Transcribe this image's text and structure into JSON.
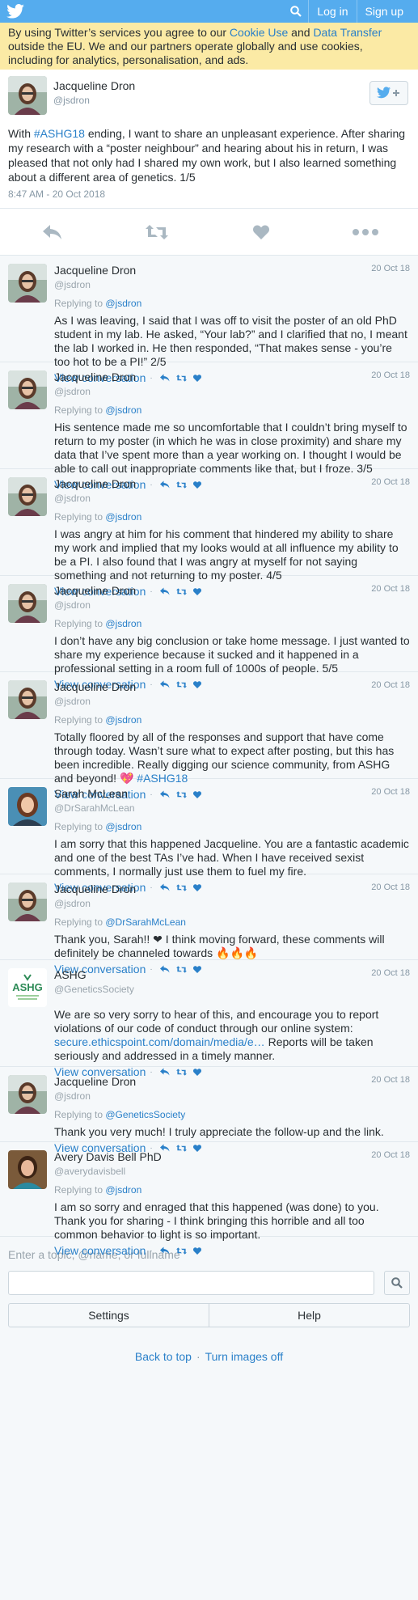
{
  "topbar": {
    "login": "Log in",
    "signup": "Sign up"
  },
  "cookie": {
    "pre": "By using Twitter’s services you agree to our ",
    "cookie_link": "Cookie Use",
    "mid": " and ",
    "transfer_link": "Data Transfer",
    "post": " outside the EU. We and our partners operate globally and use cookies, including for analytics, personalisation, and ads."
  },
  "main_tweet": {
    "name": "Jacqueline Dron",
    "handle": "@jsdron",
    "text_pre": "With ",
    "hashtag": "#ASHG18",
    "text_post": " ending, I want to share an unpleasant experience. After sharing my research with a “poster neighbour” and hearing about his in return, I was pleased that not only had I shared my own work, but I also learned something about a different area of genetics. 1/5",
    "time": "8:47 AM - 20 Oct 2018"
  },
  "tweets": [
    {
      "name": "Jacqueline Dron",
      "handle": "@jsdron",
      "date": "20 Oct 18",
      "replying": "Replying to ",
      "reply_to": "@jsdron",
      "text": "As I was leaving, I said that I was off to visit the poster of an old PhD student in my lab. He asked, “Your lab?” and I clarified that no, I meant the lab I worked in. He then responded, “That makes sense - you’re too hot to be a PI!” 2/5",
      "view": "View conversation"
    },
    {
      "name": "Jacqueline Dron",
      "handle": "@jsdron",
      "date": "20 Oct 18",
      "replying": "Replying to ",
      "reply_to": "@jsdron",
      "text": "His sentence made me so uncomfortable that I couldn’t bring myself to return to my poster (in which he was in close proximity) and share my data that I’ve spent more than a year working on. I thought I would be able to call out inappropriate comments like that, but I froze. 3/5",
      "view": "View conversation"
    },
    {
      "name": "Jacqueline Dron",
      "handle": "@jsdron",
      "date": "20 Oct 18",
      "replying": "Replying to ",
      "reply_to": "@jsdron",
      "text": "I was angry at him for his comment that hindered my ability to share my work and implied that my looks would at all influence my ability to be a PI. I also found that I was angry at myself for not saying something and not returning to my poster. 4/5",
      "view": "View conversation"
    },
    {
      "name": "Jacqueline Dron",
      "handle": "@jsdron",
      "date": "20 Oct 18",
      "replying": "Replying to ",
      "reply_to": "@jsdron",
      "text": "I don’t have any big conclusion or take home message. I just wanted to share my experience because it sucked and it happened in a professional setting in a room full of 1000s of people. 5/5",
      "view": "View conversation"
    },
    {
      "name": "Jacqueline Dron",
      "handle": "@jsdron",
      "date": "20 Oct 18",
      "replying": "Replying to ",
      "reply_to": "@jsdron",
      "text": "Totally floored by all of the responses and support that have come through today. Wasn’t sure what to expect after posting, but this has been incredible. Really digging our science community, from ASHG and beyond! 💖 ",
      "text_link": "#ASHG18",
      "view": "View conversation"
    },
    {
      "name": "Sarah McLean",
      "handle": "@DrSarahMcLean",
      "date": "20 Oct 18",
      "replying": "Replying to ",
      "reply_to": "@jsdron",
      "text": "I am sorry that this happened Jacqueline. You are a fantastic academic and one of the best TAs I’ve had. When I have received sexist comments, I normally just use them to fuel my fire.",
      "view": "View conversation"
    },
    {
      "name": "Jacqueline Dron",
      "handle": "@jsdron",
      "date": "20 Oct 18",
      "replying": "Replying to ",
      "reply_to": "@DrSarahMcLean",
      "text": "Thank you, Sarah!! ❤ I think moving forward, these comments will definitely be channeled towards 🔥🔥🔥",
      "view": "View conversation"
    },
    {
      "name": "ASHG",
      "handle": "@GeneticsSociety",
      "date": "20 Oct 18",
      "replying": "",
      "text": "We are so very sorry to hear of this, and encourage you to report violations of our code of conduct through our online system: ",
      "text_link": "secure.ethicspoint.com/domain/media/e…",
      "text_after": " Reports will be taken seriously and addressed in a timely manner.",
      "view": "View conversation"
    },
    {
      "name": "Jacqueline Dron",
      "handle": "@jsdron",
      "date": "20 Oct 18",
      "replying": "Replying to ",
      "reply_to": "@GeneticsSociety",
      "text": "Thank you very much! I truly appreciate the follow-up and the link.",
      "view": "View conversation"
    },
    {
      "name": "Avery Davis Bell PhD",
      "handle": "@averydavisbell",
      "date": "20 Oct 18",
      "replying": "Replying to ",
      "reply_to": "@jsdron",
      "text": "I am so sorry and enraged that this happened (was done) to you. Thank you for sharing - I think bringing this horrible and all too common behavior to light is so important.",
      "view": "View conversation"
    }
  ],
  "search": {
    "hint": "Enter a topic, @name, or fullname"
  },
  "buttons": {
    "settings": "Settings",
    "help": "Help"
  },
  "footer": {
    "back_to_top": "Back to top",
    "turn_images_off": "Turn images off",
    "sep": "·"
  },
  "colors": {
    "brand": "#55acee",
    "link": "#2a80c9",
    "cookie_bg": "#fbeaa5"
  }
}
